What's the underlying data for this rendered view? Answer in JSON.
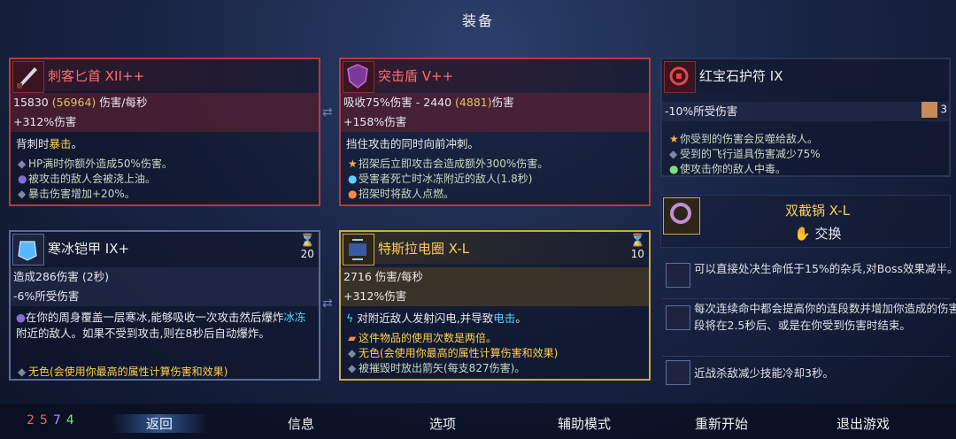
{
  "title": "装备",
  "cards": {
    "dagger": {
      "name": "刺客匕首 XII++",
      "dps": "15830",
      "dps_alt": "(56964)",
      "dps_unit": "伤害/每秒",
      "dmg": "+312%伤害",
      "trigger": "背刺时暴击。",
      "subs": [
        "HP满时你额外造成50%伤害。",
        "被攻击的敌人会被浇上油。",
        "暴击伤害增加+20%。"
      ],
      "icon": "dagger-icon"
    },
    "shield": {
      "name": "突击盾 V++",
      "stat_prefix": "吸收75%伤害 - 2440",
      "stat_alt": "(4881)",
      "stat_unit": "伤害",
      "dmg": "+158%伤害",
      "trigger": "挡住攻击的同时向前冲刺。",
      "subs": [
        "招架后立即攻击会造成额外300%伤害。",
        "受害者死亡时冰冻附近的敌人(1.8秒)",
        "招架时将敌人点燃。"
      ],
      "icon": "shield-icon"
    },
    "ruby": {
      "name": "红宝石护符 IX",
      "stat": "-10%所受伤害",
      "badge": "3",
      "subs": [
        "你受到的伤害会反噬给敌人。",
        "受到的飞行道具伤害减少75%",
        "使攻击你的敌人中毒。"
      ],
      "icon": "amulet-icon"
    },
    "armor": {
      "name": "寒冰铠甲 IX+",
      "count": "20",
      "dmg": "造成286伤害 (2秒)",
      "def": "-6%所受伤害",
      "text": "在你的周身覆盖一层寒冰,能够吸收一次攻击然后爆炸冰冻附近的敌人。如果不受到攻击,则在8秒后自动爆炸。",
      "sub": "无色(会使用你最高的属性计算伤害和效果)",
      "icon": "ice-armor-icon"
    },
    "tesla": {
      "name": "特斯拉电圈 X-L",
      "count": "10",
      "dps": "2716 伤害/每秒",
      "dmg": "+312%伤害",
      "trigger": "对附近敌人发射闪电,并导致电击。",
      "subs": [
        "这件物品的使用次数是两倍。",
        "无色(会使用你最高的属性计算伤害和效果)",
        "被摧毁时放出箭矢(每支827伤害)。"
      ],
      "icon": "tesla-coil-icon"
    },
    "pan": {
      "name": "双截锅 X-L",
      "swap": "交换",
      "icon": "pan-icon"
    }
  },
  "mutations": [
    {
      "text": "可以直接处决生命低于15%的杂兵,对Boss效果减半。",
      "icon": "execute-icon"
    },
    {
      "text": "每次连续命中都会提高你的连段数并增加你造成的伤害。连段将在2.5秒后、或是在你受到伤害时结束。",
      "icon": "combo-icon"
    },
    {
      "text": "近战杀敌减少技能冷却3秒。",
      "icon": "cooldown-icon"
    }
  ],
  "scrolls": {
    "brutality": "25",
    "tactics": "7",
    "survival": "4"
  },
  "menu": [
    "返回",
    "信息",
    "选项",
    "辅助模式",
    "重新开始",
    "退出游戏"
  ],
  "colors": {
    "brutality": "#ff5a5a",
    "tactics": "#b490ff",
    "survival": "#7ee07a",
    "accent_gold": "#c9a94a",
    "accent_red": "#b93a3c"
  }
}
